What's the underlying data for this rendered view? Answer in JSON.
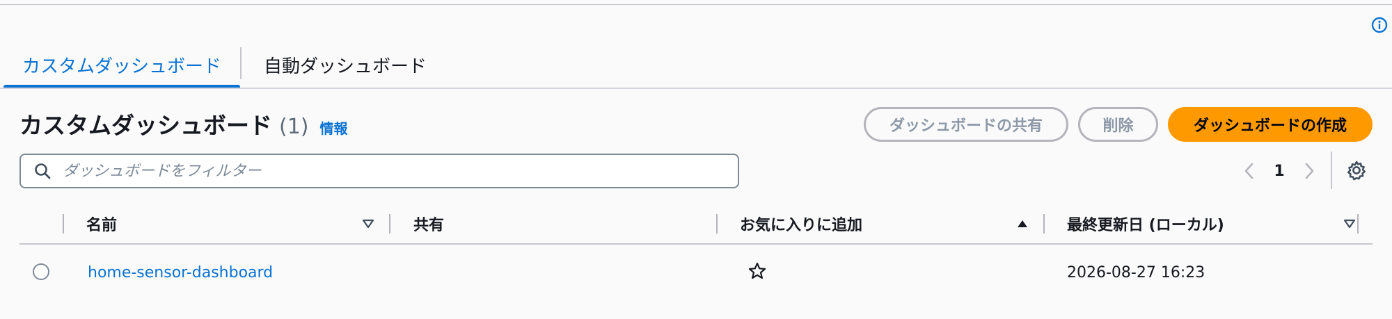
{
  "tabs": [
    {
      "label": "カスタムダッシュボード",
      "active": true
    },
    {
      "label": "自動ダッシュボード",
      "active": false
    }
  ],
  "header": {
    "title": "カスタムダッシュボード",
    "count": "(1)",
    "info_link": "情報"
  },
  "actions": {
    "share_label": "ダッシュボードの共有",
    "delete_label": "削除",
    "create_label": "ダッシュボードの作成"
  },
  "filter": {
    "placeholder": "ダッシュボードをフィルター",
    "value": ""
  },
  "pagination": {
    "current_page": "1"
  },
  "table": {
    "columns": [
      {
        "label": "名前",
        "sort": "none"
      },
      {
        "label": "共有",
        "sort": "unsortable"
      },
      {
        "label": "お気に入りに追加",
        "sort": "ascending"
      },
      {
        "label": "最終更新日 (ローカル)",
        "sort": "none"
      }
    ],
    "rows": [
      {
        "name": "home-sensor-dashboard",
        "shared": "",
        "favorite": false,
        "last_updated": "2026-08-27 16:23"
      }
    ]
  },
  "icons": {
    "info": "info-circle-icon",
    "search": "search-icon",
    "prev": "chevron-left-icon",
    "next": "chevron-right-icon",
    "settings": "gear-icon",
    "sort_none": "caret-down-outline-icon",
    "sort_asc": "caret-up-filled-icon",
    "favorite": "star-outline-icon"
  },
  "colors": {
    "link": "#0972d3",
    "primary_button": "#ff9900",
    "disabled": "#8d99a8",
    "text": "#16191f"
  }
}
